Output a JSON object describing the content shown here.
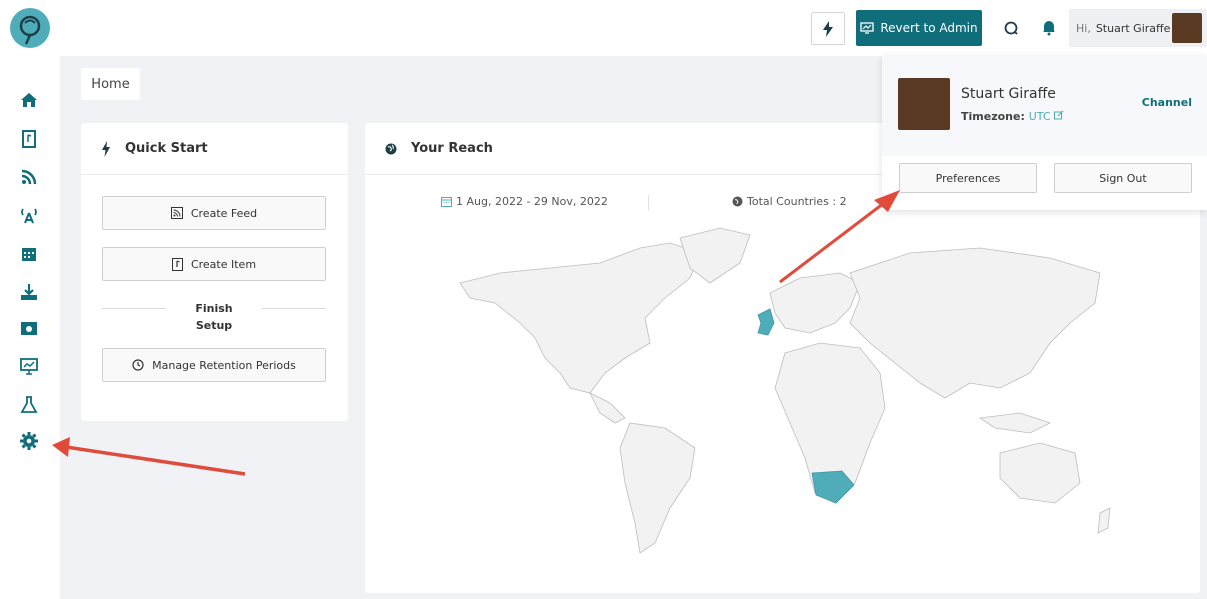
{
  "topbar": {
    "revert_label": "Revert to Admin",
    "greeting": "Hi,",
    "user_name": "Stuart Giraffe"
  },
  "breadcrumb": {
    "home": "Home"
  },
  "quick_start": {
    "title": "Quick Start",
    "create_feed": "Create Feed",
    "create_item": "Create Item",
    "finish_setup": "Finish Setup",
    "manage_retention": "Manage Retention Periods"
  },
  "reach": {
    "title": "Your Reach",
    "date_range": "1 Aug, 2022 - 29 Nov, 2022",
    "total_countries": "Total Countries : 2"
  },
  "user_popup": {
    "name": "Stuart Giraffe",
    "timezone_label": "Timezone:",
    "timezone_value": "UTC",
    "channel": "Channel",
    "preferences": "Preferences",
    "sign_out": "Sign Out"
  },
  "sidebar": {
    "icons": [
      "home-icon",
      "item-icon",
      "rss-icon",
      "broadcast-icon",
      "calendar-icon",
      "download-icon",
      "media-icon",
      "analytics-icon",
      "lab-icon",
      "settings-icon"
    ]
  },
  "colors": {
    "accent": "#106e7b",
    "highlight": "#4eadb9",
    "arrow": "#e04b3c"
  }
}
